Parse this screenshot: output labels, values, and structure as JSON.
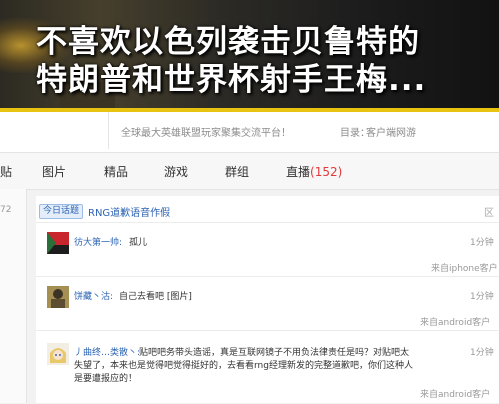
{
  "headline": {
    "line1": "不喜欢以色列袭击贝鲁特的",
    "line2": "特朗普和世界杯射手王梅..."
  },
  "header": {
    "slogan": "全球最大英雄联盟玩家聚集交流平台！",
    "directory_label": "目录：",
    "directory_value": "客户端网游"
  },
  "tabs": [
    {
      "label": "贴"
    },
    {
      "label": "图片"
    },
    {
      "label": "精品"
    },
    {
      "label": "游戏"
    },
    {
      "label": "群组"
    },
    {
      "label": "直播",
      "count": "(152)"
    }
  ],
  "left_number": "72",
  "thread": {
    "tag": "今日话题",
    "title": "RNG道歉语音作假",
    "mark": "区"
  },
  "posts": [
    {
      "user": "彷大第一帅:",
      "text": "孤儿",
      "time": "1分钟",
      "source": "来自iphone客户"
    },
    {
      "user": "饼藏丶沽:",
      "text": "自己去看吧 [图片]",
      "time": "1分钟",
      "source": "来自android客户"
    },
    {
      "user": "丿曲终…类散丶:",
      "line1": "贴吧吧务带头造谣，真是互联网镜子不用负法律责任是吗？对贴吧太",
      "line2": "失望了，本来也是觉得吧觉得挺好的，去看看rng经理新发的完整道歉吧，你们这种人",
      "line3": "是要遭报应的！",
      "time": "1分钟",
      "source": "来自android客户"
    }
  ],
  "colors": {
    "accent_yellow": "#e9c312",
    "link_blue": "#2d64b3",
    "count_red": "#e4393c"
  }
}
